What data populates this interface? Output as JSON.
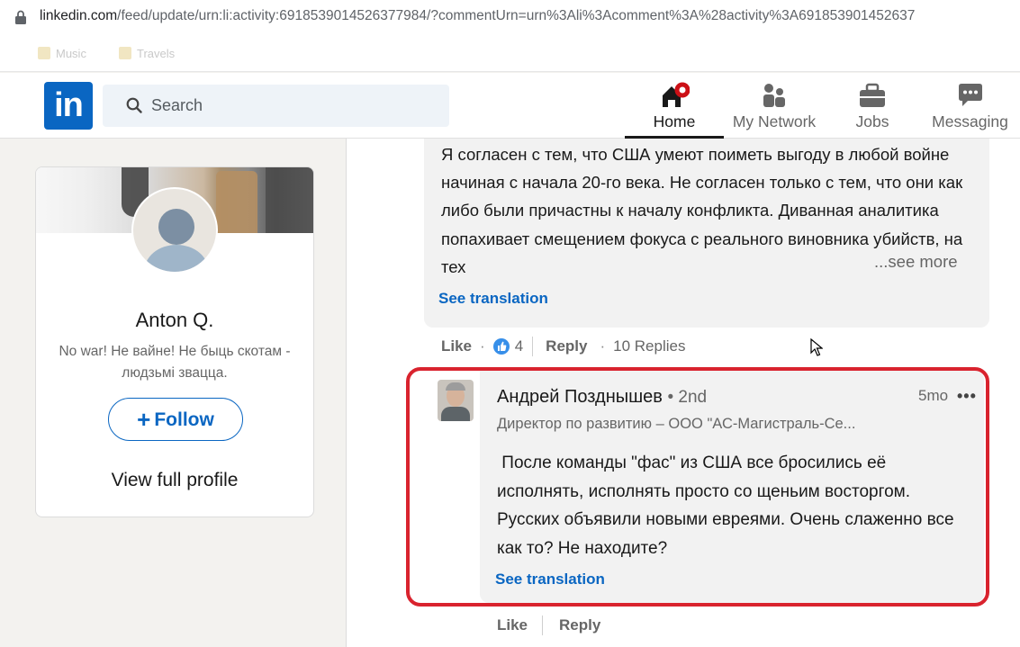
{
  "browser": {
    "url_host": "linkedin.com",
    "url_path": "/feed/update/urn:li:activity:6918539014526377984/?commentUrn=urn%3Ali%3Acomment%3A%28activity%3A691853901452637"
  },
  "bookmarks": [
    "Music",
    "Travels"
  ],
  "nav": {
    "logo_text": "in",
    "search_placeholder": "Search",
    "items": [
      {
        "label": "Home"
      },
      {
        "label": "My Network"
      },
      {
        "label": "Jobs"
      },
      {
        "label": "Messaging"
      }
    ]
  },
  "profile": {
    "name": "Anton Q.",
    "tagline": "No war! Не вайне! Не быць скотам - людзьмі звацца.",
    "follow_label": "Follow",
    "view_full": "View full profile"
  },
  "comment1": {
    "text": "Я согласен с тем, что США умеют поиметь выгоду в любой войне начиная с начала 20-го века. Не согласен только с тем, что они как либо были причастны к началу конфликта. Диванная аналитика попахивает смещением фокуса с реального виновника убийств, на тех",
    "see_more": "...see more",
    "see_translation": "See translation",
    "like_label": "Like",
    "reaction_count": "4",
    "reply_label": "Reply",
    "replies": "10 Replies"
  },
  "comment2": {
    "author": "Андрей Позднышев",
    "degree": "• 2nd",
    "time": "5mo",
    "menu": "•••",
    "headline": "Директор по развитию – ООО \"АС-Магистраль-Се...",
    "text": " После команды \"фас\" из США все бросились её исполнять, исполнять просто со щеньим восторгом. Русских объявили новыми евреями. Очень слаженно все как то? Не находите?",
    "see_translation": "See translation",
    "like_label": "Like",
    "reply_label": "Reply"
  },
  "colors": {
    "linkedin_blue": "#0a66c2",
    "highlight_red": "#d9232e",
    "notification_red": "#cc1016"
  }
}
